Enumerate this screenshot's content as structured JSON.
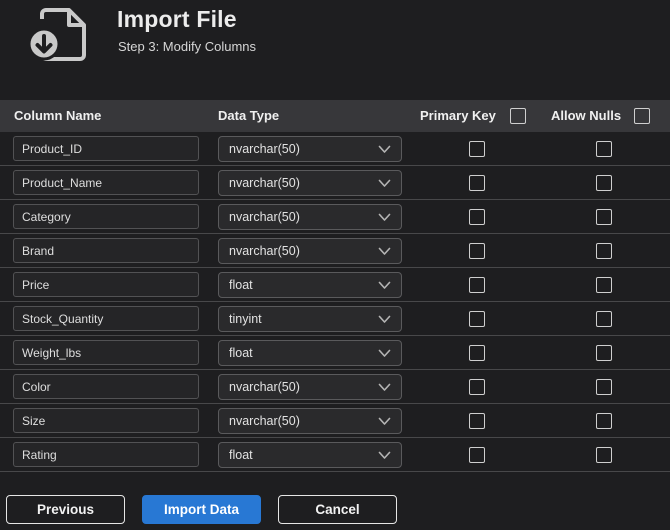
{
  "header": {
    "title": "Import File",
    "subtitle": "Step 3: Modify Columns",
    "icon": "import-file-icon"
  },
  "table": {
    "headers": {
      "column_name": "Column Name",
      "data_type": "Data Type",
      "primary_key": "Primary Key",
      "allow_nulls": "Allow Nulls"
    },
    "header_checkboxes": {
      "primary_key_all_checked": false,
      "allow_nulls_all_checked": false
    },
    "rows": [
      {
        "column_name": "Product_ID",
        "data_type": "nvarchar(50)",
        "primary_key": false,
        "allow_nulls": false
      },
      {
        "column_name": "Product_Name",
        "data_type": "nvarchar(50)",
        "primary_key": false,
        "allow_nulls": false
      },
      {
        "column_name": "Category",
        "data_type": "nvarchar(50)",
        "primary_key": false,
        "allow_nulls": false
      },
      {
        "column_name": "Brand",
        "data_type": "nvarchar(50)",
        "primary_key": false,
        "allow_nulls": false
      },
      {
        "column_name": "Price",
        "data_type": "float",
        "primary_key": false,
        "allow_nulls": false
      },
      {
        "column_name": "Stock_Quantity",
        "data_type": "tinyint",
        "primary_key": false,
        "allow_nulls": false
      },
      {
        "column_name": "Weight_lbs",
        "data_type": "float",
        "primary_key": false,
        "allow_nulls": false
      },
      {
        "column_name": "Color",
        "data_type": "nvarchar(50)",
        "primary_key": false,
        "allow_nulls": false
      },
      {
        "column_name": "Size",
        "data_type": "nvarchar(50)",
        "primary_key": false,
        "allow_nulls": false
      },
      {
        "column_name": "Rating",
        "data_type": "float",
        "primary_key": false,
        "allow_nulls": false
      }
    ]
  },
  "footer": {
    "previous_label": "Previous",
    "import_label": "Import Data",
    "cancel_label": "Cancel"
  },
  "colors": {
    "background": "#1e1e20",
    "header_strip": "#37373a",
    "accent_blue": "#2878d4",
    "row_separator": "#48484a"
  }
}
